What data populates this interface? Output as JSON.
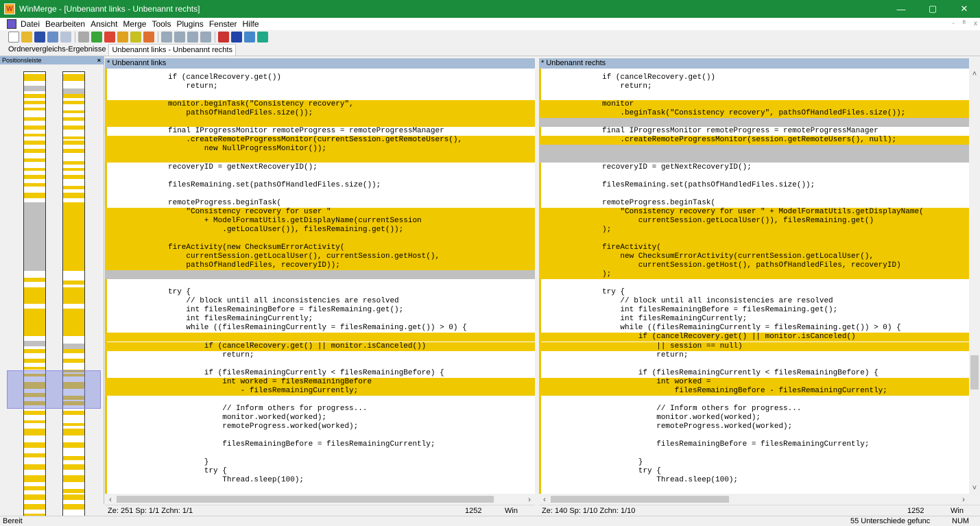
{
  "window": {
    "title": "WinMerge - [Unbenannt links - Unbenannt rechts]",
    "minimize": "—",
    "maximize": "▢",
    "close": "✕"
  },
  "menu": {
    "items": [
      "Datei",
      "Bearbeiten",
      "Ansicht",
      "Merge",
      "Tools",
      "Plugins",
      "Fenster",
      "Hilfe"
    ],
    "mdi_restore": "-",
    "mdi_max": "ᴮ",
    "mdi_close": "x"
  },
  "tabs": [
    "Ordnervergleichs-Ergebnisse",
    "Unbenannt links - Unbenannt rechts"
  ],
  "location_pane": {
    "title": "Positionsleiste",
    "close": "×"
  },
  "left_pane": {
    "header": "* Unbenannt links",
    "lines": [
      {
        "t": "if (cancelRecovery.get())",
        "k": "n"
      },
      {
        "t": "    return;",
        "k": "n"
      },
      {
        "t": "",
        "k": "n"
      },
      {
        "t": "monitor.beginTask(\"Consistency recovery\",",
        "k": "d"
      },
      {
        "t": "    pathsOfHandledFiles.size());",
        "k": "d"
      },
      {
        "t": "",
        "k": "d"
      },
      {
        "t": "final IProgressMonitor remoteProgress = remoteProgressManager",
        "k": "n"
      },
      {
        "t": "    .createRemoteProgressMonitor(currentSession.getRemoteUsers(),",
        "k": "d"
      },
      {
        "t": "        new NullProgressMonitor());",
        "k": "d"
      },
      {
        "t": "",
        "k": "d"
      },
      {
        "t": "recoveryID = getNextRecoveryID();",
        "k": "n"
      },
      {
        "t": "",
        "k": "n"
      },
      {
        "t": "filesRemaining.set(pathsOfHandledFiles.size());",
        "k": "n"
      },
      {
        "t": "",
        "k": "n"
      },
      {
        "t": "remoteProgress.beginTask(",
        "k": "n"
      },
      {
        "t": "    \"Consistency recovery for user \"",
        "k": "d"
      },
      {
        "t": "        + ModelFormatUtils.getDisplayName(currentSession",
        "k": "d"
      },
      {
        "t": "            .getLocalUser()), filesRemaining.get());",
        "k": "d"
      },
      {
        "t": "",
        "k": "d"
      },
      {
        "t": "fireActivity(new ChecksumErrorActivity(",
        "k": "d"
      },
      {
        "t": "    currentSession.getLocalUser(), currentSession.getHost(),",
        "k": "d"
      },
      {
        "t": "    pathsOfHandledFiles, recoveryID));",
        "k": "d"
      },
      {
        "t": "",
        "k": "g"
      },
      {
        "t": "",
        "k": "n"
      },
      {
        "t": "try {",
        "k": "n"
      },
      {
        "t": "    // block until all inconsistencies are resolved",
        "k": "n"
      },
      {
        "t": "    int filesRemainingBefore = filesRemaining.get();",
        "k": "n"
      },
      {
        "t": "    int filesRemainingCurrently;",
        "k": "n"
      },
      {
        "t": "    while ((filesRemainingCurrently = filesRemaining.get()) > 0) {",
        "k": "n"
      },
      {
        "t": "",
        "k": "d"
      },
      {
        "t": "        if (cancelRecovery.get() || monitor.isCanceled())",
        "k": "d"
      },
      {
        "t": "            return;",
        "k": "n"
      },
      {
        "t": "",
        "k": "n"
      },
      {
        "t": "        if (filesRemainingCurrently < filesRemainingBefore) {",
        "k": "n"
      },
      {
        "t": "            int worked = filesRemainingBefore",
        "k": "d"
      },
      {
        "t": "                - filesRemainingCurrently;",
        "k": "d"
      },
      {
        "t": "",
        "k": "n"
      },
      {
        "t": "            // Inform others for progress...",
        "k": "n"
      },
      {
        "t": "            monitor.worked(worked);",
        "k": "n"
      },
      {
        "t": "            remoteProgress.worked(worked);",
        "k": "n"
      },
      {
        "t": "",
        "k": "n"
      },
      {
        "t": "            filesRemainingBefore = filesRemainingCurrently;",
        "k": "n"
      },
      {
        "t": "",
        "k": "n"
      },
      {
        "t": "        }",
        "k": "n"
      },
      {
        "t": "        try {",
        "k": "n"
      },
      {
        "t": "            Thread.sleep(100);",
        "k": "n"
      }
    ]
  },
  "right_pane": {
    "header": "* Unbenannt rechts",
    "lines": [
      {
        "t": "if (cancelRecovery.get())",
        "k": "n"
      },
      {
        "t": "    return;",
        "k": "n"
      },
      {
        "t": "",
        "k": "n"
      },
      {
        "t": "monitor",
        "k": "d"
      },
      {
        "t": "    .beginTask(\"Consistency recovery\", pathsOfHandledFiles.size());",
        "k": "d"
      },
      {
        "t": "",
        "k": "g"
      },
      {
        "t": "final IProgressMonitor remoteProgress = remoteProgressManager",
        "k": "n"
      },
      {
        "t": "    .createRemoteProgressMonitor(session.getRemoteUsers(), null);",
        "k": "d"
      },
      {
        "t": "",
        "k": "g"
      },
      {
        "t": "",
        "k": "g"
      },
      {
        "t": "recoveryID = getNextRecoveryID();",
        "k": "n"
      },
      {
        "t": "",
        "k": "n"
      },
      {
        "t": "filesRemaining.set(pathsOfHandledFiles.size());",
        "k": "n"
      },
      {
        "t": "",
        "k": "n"
      },
      {
        "t": "remoteProgress.beginTask(",
        "k": "n"
      },
      {
        "t": "    \"Consistency recovery for user \" + ModelFormatUtils.getDisplayName(",
        "k": "d"
      },
      {
        "t": "        currentSession.getLocalUser()), filesRemaining.get()",
        "k": "d"
      },
      {
        "t": ");",
        "k": "d"
      },
      {
        "t": "",
        "k": "d"
      },
      {
        "t": "fireActivity(",
        "k": "d"
      },
      {
        "t": "    new ChecksumErrorActivity(currentSession.getLocalUser(),",
        "k": "d"
      },
      {
        "t": "        currentSession.getHost(), pathsOfHandledFiles, recoveryID)",
        "k": "d"
      },
      {
        "t": ");",
        "k": "d"
      },
      {
        "t": "",
        "k": "n"
      },
      {
        "t": "try {",
        "k": "n"
      },
      {
        "t": "    // block until all inconsistencies are resolved",
        "k": "n"
      },
      {
        "t": "    int filesRemainingBefore = filesRemaining.get();",
        "k": "n"
      },
      {
        "t": "    int filesRemainingCurrently;",
        "k": "n"
      },
      {
        "t": "    while ((filesRemainingCurrently = filesRemaining.get()) > 0) {",
        "k": "n"
      },
      {
        "t": "        if (cancelRecovery.get() || monitor.isCanceled()",
        "k": "d"
      },
      {
        "t": "            || session == null)",
        "k": "d"
      },
      {
        "t": "            return;",
        "k": "n"
      },
      {
        "t": "",
        "k": "n"
      },
      {
        "t": "        if (filesRemainingCurrently < filesRemainingBefore) {",
        "k": "n"
      },
      {
        "t": "            int worked =",
        "k": "d"
      },
      {
        "t": "                filesRemainingBefore - filesRemainingCurrently;",
        "k": "d"
      },
      {
        "t": "",
        "k": "n"
      },
      {
        "t": "            // Inform others for progress...",
        "k": "n"
      },
      {
        "t": "            monitor.worked(worked);",
        "k": "n"
      },
      {
        "t": "            remoteProgress.worked(worked);",
        "k": "n"
      },
      {
        "t": "",
        "k": "n"
      },
      {
        "t": "            filesRemainingBefore = filesRemainingCurrently;",
        "k": "n"
      },
      {
        "t": "",
        "k": "n"
      },
      {
        "t": "        }",
        "k": "n"
      },
      {
        "t": "        try {",
        "k": "n"
      },
      {
        "t": "            Thread.sleep(100);",
        "k": "n"
      }
    ]
  },
  "left_status": {
    "pos": "Ze: 251  Sp: 1/1  Zchn: 1/1",
    "codepage": "1252",
    "eol": "Win"
  },
  "right_status": {
    "pos": "Ze: 140  Sp: 1/10  Zchn: 1/10",
    "codepage": "1252",
    "eol": "Win"
  },
  "statusbar": {
    "left": "Bereit",
    "diffs": "55 Unterschiede gefunc",
    "num": "NUM"
  },
  "colors": {
    "diff": "#f0c800",
    "gap": "#c0c0c0",
    "titlebar": "#1a8c3b",
    "pane_header": "#a6bcd6"
  }
}
